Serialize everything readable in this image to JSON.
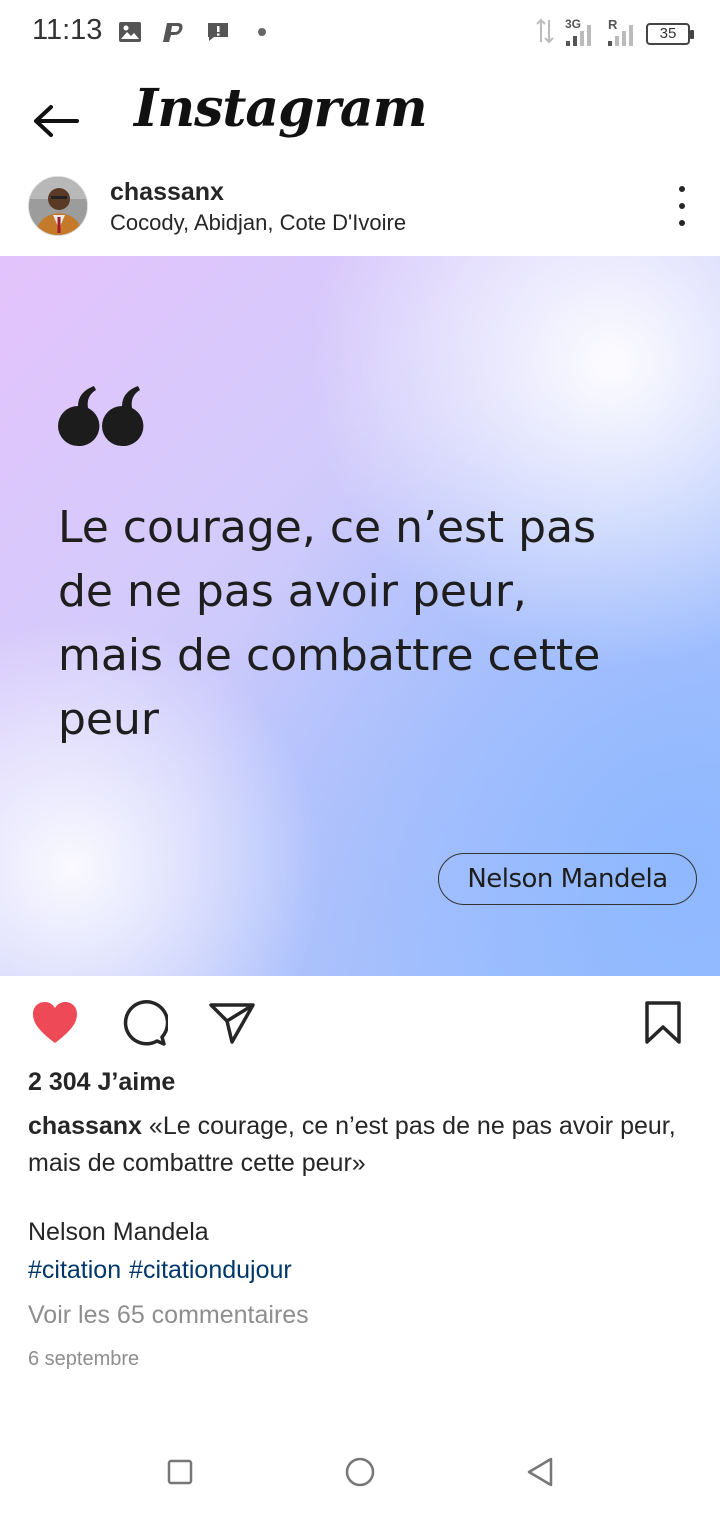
{
  "status_bar": {
    "time": "11:13",
    "network": "3G",
    "roaming": "R",
    "battery": "35"
  },
  "header": {
    "title": "Instagram",
    "back_icon": "arrow-left-icon"
  },
  "post": {
    "username": "chassanx",
    "location": "Cocody, Abidjan, Cote D'Ivoire",
    "image": {
      "quote_lines": [
        "Le courage, ce n’est pas",
        "de ne pas avoir peur,",
        "mais de combattre cette",
        "peur"
      ],
      "author": "Nelson Mandela"
    },
    "actions": {
      "like_icon": "heart-filled-icon",
      "comment_icon": "comment-icon",
      "share_icon": "send-icon",
      "save_icon": "bookmark-icon",
      "like_color": "#ed4956"
    },
    "likes": "2 304 J’aime",
    "caption_user": "chassanx",
    "caption_text": "«Le courage, ce n’est pas de ne pas avoir peur, mais de combattre cette peur»",
    "caption_author": "Nelson Mandela",
    "hashtags": [
      "#citation",
      "#citationdujour"
    ],
    "view_comments": "Voir les 65 commentaires",
    "date": "6 septembre"
  },
  "colors": {
    "hashtag": "#00376b",
    "muted_text": "#8e8e8e"
  }
}
